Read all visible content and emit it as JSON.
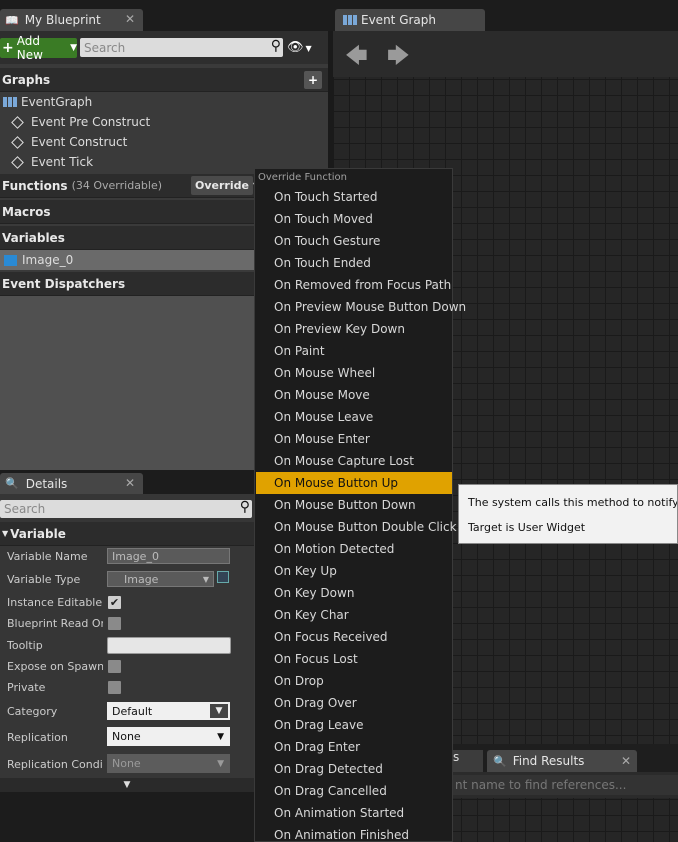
{
  "my_blueprint": {
    "tab_title": "My Blueprint",
    "add_new_label": "Add New",
    "search_placeholder": "Search",
    "graphs_header": "Graphs",
    "graph_items": [
      "EventGraph",
      "Event Pre Construct",
      "Event Construct",
      "Event Tick"
    ],
    "functions_header": "Functions",
    "functions_count": "(34 Overridable)",
    "override_label": "Override",
    "macros_header": "Macros",
    "variables_header": "Variables",
    "variable_item": "Image_0",
    "dispatchers_header": "Event Dispatchers"
  },
  "details": {
    "tab_title": "Details",
    "search_placeholder": "Search",
    "section": "Variable",
    "rows": [
      {
        "label": "Variable Name",
        "value": "Image_0"
      },
      {
        "label": "Variable Type",
        "value": "Image"
      },
      {
        "label": "Instance Editable",
        "value": "checked"
      },
      {
        "label": "Blueprint Read Onl",
        "value": "unchecked"
      },
      {
        "label": "Tooltip",
        "value": ""
      },
      {
        "label": "Expose on Spawn",
        "value": "unchecked"
      },
      {
        "label": "Private",
        "value": "unchecked"
      },
      {
        "label": "Category",
        "value": "Default"
      },
      {
        "label": "Replication",
        "value": "None"
      },
      {
        "label": "Replication Conditi",
        "value": "None"
      }
    ]
  },
  "event_graph": {
    "tab_title": "Event Graph"
  },
  "bottom": {
    "tab_partial": "s",
    "find_results_tab": "Find Results",
    "find_placeholder": "nt name to find references..."
  },
  "override_menu": {
    "header": "Override Function",
    "items": [
      "On Touch Started",
      "On Touch Moved",
      "On Touch Gesture",
      "On Touch Ended",
      "On Removed from Focus Path",
      "On Preview Mouse Button Down",
      "On Preview Key Down",
      "On Paint",
      "On Mouse Wheel",
      "On Mouse Move",
      "On Mouse Leave",
      "On Mouse Enter",
      "On Mouse Capture Lost",
      "On Mouse Button Up",
      "On Mouse Button Down",
      "On Mouse Button Double Click",
      "On Motion Detected",
      "On Key Up",
      "On Key Down",
      "On Key Char",
      "On Focus Received",
      "On Focus Lost",
      "On Drop",
      "On Drag Over",
      "On Drag Leave",
      "On Drag Enter",
      "On Drag Detected",
      "On Drag Cancelled",
      "On Animation Started",
      "On Animation Finished"
    ],
    "selected": "On Mouse Button Up"
  },
  "tooltip": {
    "line1": "The system calls this method to notify the",
    "line2": "Target is User Widget"
  },
  "colors": {
    "accent_add": "#3a7b25",
    "menu_selection": "#e0a200"
  }
}
